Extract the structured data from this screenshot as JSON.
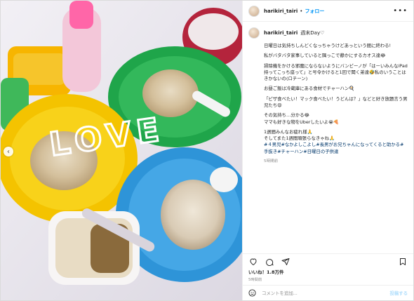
{
  "post": {
    "username": "harikiri_tairi",
    "dot": "•",
    "follow_label": "フォロー",
    "more_label": "•••",
    "caption_title": "週末Day♡",
    "caption_paragraphs": [
      "日曜日は気持ちしんどくなっちゃうけどあっという間に終わる!",
      "私がバタバタ家事していると隅っこで静かにするカオス達😂",
      "掃除機をかける邪魔にならないようにバンビーノが「はーいみんなiPad持ってこっち座って」と号令かけると1回で聞く弟達🤣私のいうことはきかないの(ロチーン)",
      "お昼ご飯は冷蔵庫にある食材でチャーハン🍳",
      "「ピザ食べたい！マック食べたい！うどんは？」などと好き放題言う男児たち😩",
      "その気持ち…分かる😂\nママも好きな物をUberしたいよ😭🍕",
      "1週間みんなお疲れ様🙏\nそしてまた1週間頑張らなきゃね🙏"
    ],
    "hashtags": "#４男児#なかよしこよし#長男がお兄ちゃんになってくると助かる#手抜き#チャーハン#日曜日の子供達",
    "time_ago": "5時間前",
    "likes": "いいね！1.8万件",
    "posted": "5時間前",
    "comment_placeholder": "コメントを追加...",
    "post_label": "投稿する"
  },
  "photo": {
    "overlay_text": "LOVE",
    "plate_colors": [
      "#f5c400",
      "#22a845",
      "#39a3e6"
    ],
    "icons": [
      "chevron-left-icon"
    ]
  },
  "colors": {
    "accent": "#0095f6",
    "tag": "#00376b",
    "muted": "#8e8e8e"
  }
}
